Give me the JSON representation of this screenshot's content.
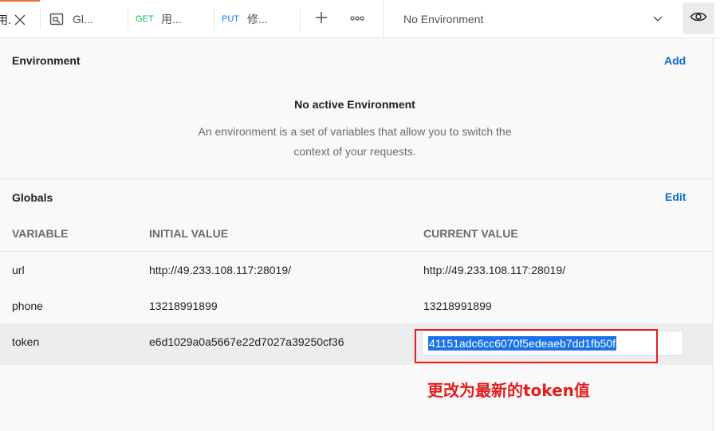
{
  "tabs": {
    "active_tab_label": "用.",
    "tab2_label": "Gl...",
    "tab3_method": "GET",
    "tab3_label": "用...",
    "tab4_method": "PUT",
    "tab4_label": "修..."
  },
  "environment_selector": {
    "selected": "No Environment"
  },
  "environment_section": {
    "title": "Environment",
    "add_label": "Add",
    "empty_heading": "No active Environment",
    "empty_description_line1": "An environment is a set of variables that allow you to switch the",
    "empty_description_line2": "context of your requests."
  },
  "globals_section": {
    "title": "Globals",
    "edit_label": "Edit",
    "columns": [
      "VARIABLE",
      "INITIAL VALUE",
      "CURRENT VALUE"
    ],
    "rows": [
      {
        "variable": "url",
        "initial": "http://49.233.108.117:28019/",
        "current": "http://49.233.108.117:28019/"
      },
      {
        "variable": "phone",
        "initial": "13218991899",
        "current": "13218991899"
      },
      {
        "variable": "token",
        "initial": "e6d1029a0a5667e22d7027a39250cf36",
        "current": "41151adc6cc6070f5edeaeb7dd1fb50f"
      }
    ]
  },
  "annotation": {
    "note": "更改为最新的token值",
    "color": "#e02020"
  },
  "colors": {
    "accent_link": "#0b6dce",
    "active_tab_indicator": "#f26b3a",
    "get_method": "#0cbb52",
    "put_method": "#097bed",
    "selection": "#1a73e8"
  }
}
